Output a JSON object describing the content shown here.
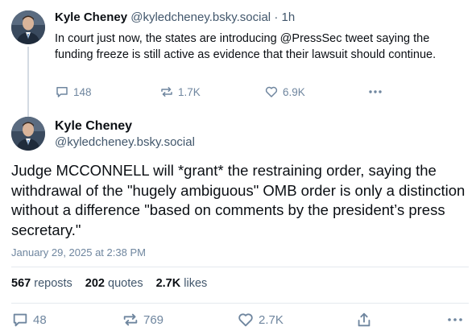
{
  "post1": {
    "author_name": "Kyle Cheney",
    "author_handle": "@kyledcheney.bsky.social",
    "time_ago": "· 1h",
    "text": "In court just now, the states are introducing @PressSec tweet saying the funding freeze is still active as evidence that their lawsuit should continue.",
    "replies": "148",
    "reposts": "1.7K",
    "likes": "6.9K"
  },
  "post2": {
    "author_name": "Kyle Cheney",
    "author_handle": "@kyledcheney.bsky.social",
    "text": "Judge MCCONNELL will *grant* the restraining order, saying the withdrawal of the \"hugely ambiguous\" OMB order is only a distinction without a difference \"based on comments by the president’s press secretary.\"",
    "date": "January 29, 2025 at 2:38 PM",
    "stats": {
      "reposts_count": "567",
      "reposts_label": "reposts",
      "quotes_count": "202",
      "quotes_label": "quotes",
      "likes_count": "2.7K",
      "likes_label": "likes"
    },
    "replies": "48",
    "reposts": "769",
    "likes": "2.7K"
  },
  "icons": [
    "avatar",
    "reply-icon",
    "repost-icon",
    "like-icon",
    "more-icon",
    "share-icon"
  ],
  "colors": {
    "text": "#0b0f14",
    "muted": "#6f869f",
    "handle": "#42576c",
    "divider": "#e4e9ee"
  }
}
